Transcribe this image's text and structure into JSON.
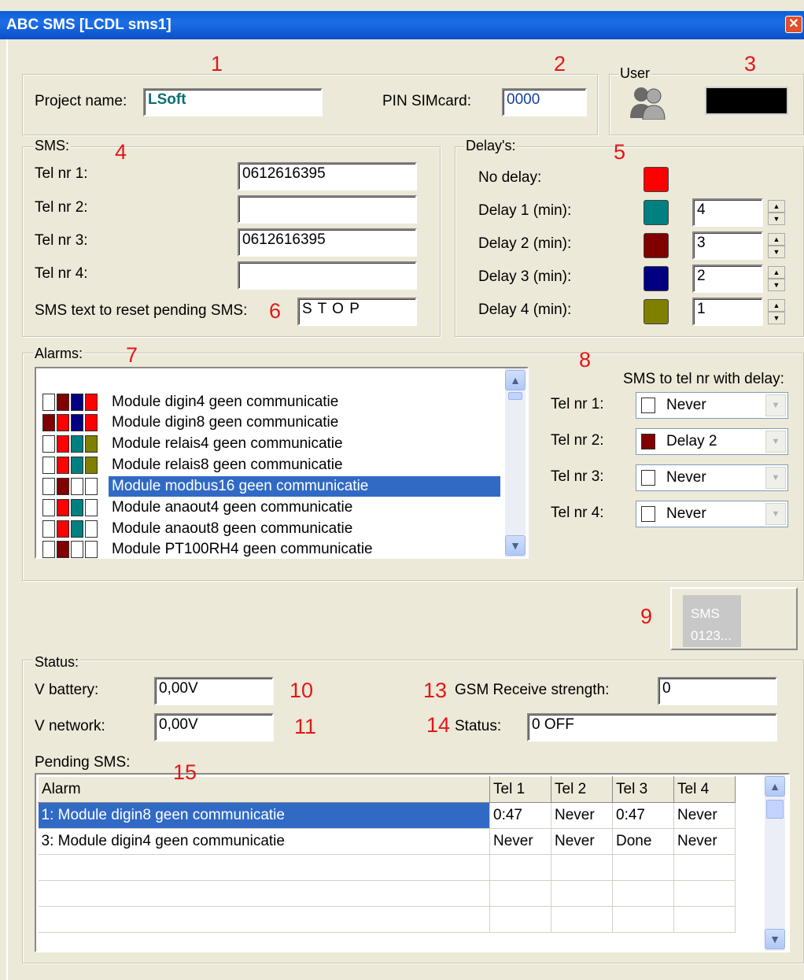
{
  "window": {
    "title": "ABC SMS [LCDL sms1]",
    "close_glyph": "✕"
  },
  "annotations": [
    "1",
    "2",
    "3",
    "4",
    "5",
    "6",
    "7",
    "8",
    "9",
    "10",
    "11",
    "13",
    "14",
    "15"
  ],
  "project": {
    "name_label": "Project name:",
    "name_value": "LSoft",
    "pin_label": "PIN SIMcard:",
    "pin_value": "0000"
  },
  "user": {
    "legend": "User",
    "icon": "users-icon",
    "display_color": "#000000"
  },
  "sms": {
    "legend": "SMS:",
    "tel_labels": [
      "Tel nr 1:",
      "Tel nr 2:",
      "Tel nr 3:",
      "Tel nr 4:"
    ],
    "tel_values": [
      "0612616395",
      "",
      "0612616395",
      ""
    ],
    "reset_label": "SMS text to reset pending SMS:",
    "reset_value": "S T O P"
  },
  "delays": {
    "legend": "Delay's:",
    "items": [
      {
        "label": "No delay:",
        "color": "#ff0000",
        "value": null
      },
      {
        "label": "Delay 1 (min):",
        "color": "#008080",
        "value": "4"
      },
      {
        "label": "Delay 2 (min):",
        "color": "#800000",
        "value": "3"
      },
      {
        "label": "Delay 3 (min):",
        "color": "#000080",
        "value": "2"
      },
      {
        "label": "Delay 4 (min):",
        "color": "#808000",
        "value": "1"
      }
    ]
  },
  "alarms": {
    "legend": "Alarms:",
    "items": [
      {
        "text": "Module digin4 geen communicatie",
        "colors": [
          "#ffffff",
          "#800000",
          "#000080",
          "#ff0000"
        ],
        "selected": false
      },
      {
        "text": "Module digin8 geen communicatie",
        "colors": [
          "#800000",
          "#ff0000",
          "#000080",
          "#ff0000"
        ],
        "selected": false
      },
      {
        "text": "Module relais4 geen communicatie",
        "colors": [
          "#ffffff",
          "#ff0000",
          "#008080",
          "#808000"
        ],
        "selected": false
      },
      {
        "text": "Module relais8 geen communicatie",
        "colors": [
          "#ffffff",
          "#ff0000",
          "#008080",
          "#808000"
        ],
        "selected": false
      },
      {
        "text": "Module modbus16 geen communicatie",
        "colors": [
          "#ffffff",
          "#800000",
          "#ffffff",
          "#ffffff"
        ],
        "selected": true
      },
      {
        "text": "Module anaout4 geen communicatie",
        "colors": [
          "#ffffff",
          "#ff0000",
          "#008080",
          "#ffffff"
        ],
        "selected": false
      },
      {
        "text": "Module anaout8 geen communicatie",
        "colors": [
          "#ffffff",
          "#ff0000",
          "#008080",
          "#ffffff"
        ],
        "selected": false
      },
      {
        "text": "Module PT100RH4 geen  communicatie",
        "colors": [
          "#ffffff",
          "#800000",
          "#ffffff",
          "#ffffff"
        ],
        "selected": false
      }
    ],
    "delay_header": "SMS to tel nr with delay:",
    "tel_delays": [
      {
        "label": "Tel nr 1:",
        "value": "Never",
        "color": "#ffffff"
      },
      {
        "label": "Tel nr 2:",
        "value": "Delay 2",
        "color": "#800000"
      },
      {
        "label": "Tel nr 3:",
        "value": "Never",
        "color": "#ffffff"
      },
      {
        "label": "Tel nr 4:",
        "value": "Never",
        "color": "#ffffff"
      }
    ]
  },
  "send_button": {
    "line1": "SMS",
    "line2": "0123..."
  },
  "status": {
    "legend": "Status:",
    "v_battery_label": "V battery:",
    "v_battery_value": "0,00V",
    "v_network_label": "V network:",
    "v_network_value": "0,00V",
    "gsm_label": "GSM Receive strength:",
    "gsm_value": "0",
    "status_label": "Status:",
    "status_value": "0 OFF"
  },
  "pending": {
    "label": "Pending SMS:",
    "columns": [
      "Alarm",
      "Tel 1",
      "Tel 2",
      "Tel 3",
      "Tel 4"
    ],
    "rows": [
      [
        "1: Module digin8 geen communicatie",
        "0:47",
        "Never",
        "0:47",
        "Never"
      ],
      [
        "3: Module digin4 geen communicatie",
        "Never",
        "Never",
        "Done",
        "Never"
      ]
    ]
  }
}
